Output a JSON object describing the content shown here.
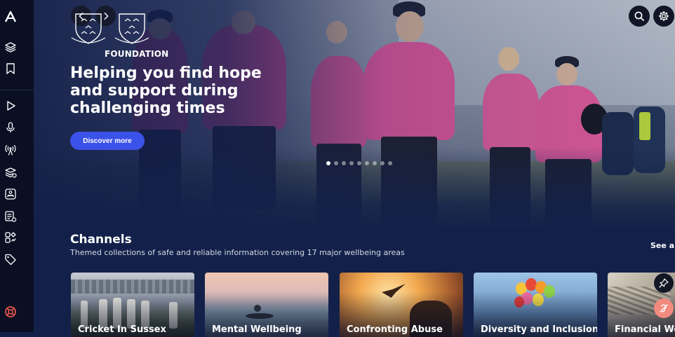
{
  "hero": {
    "title": "Helping you find hope and support during challenging times",
    "button_label": "Discover more",
    "logo_text": "FOUNDATION",
    "slide_count": 9,
    "active_slide": 1
  },
  "sidebar": {
    "items": [
      {
        "icon": "brand-logo-icon"
      },
      {
        "icon": "layers-icon"
      },
      {
        "icon": "bookmark-icon"
      },
      {
        "icon": "play-icon"
      },
      {
        "icon": "microphone-icon"
      },
      {
        "icon": "broadcast-icon"
      },
      {
        "icon": "courses-icon"
      },
      {
        "icon": "meditation-icon"
      },
      {
        "icon": "articles-icon"
      },
      {
        "icon": "apps-icon"
      },
      {
        "icon": "tag-icon"
      },
      {
        "icon": "lifebuoy-icon"
      }
    ]
  },
  "channels": {
    "title": "Channels",
    "subtitle": "Themed collections of safe and reliable information covering 17 major wellbeing areas",
    "see_all": "See all",
    "cards": [
      {
        "label": "Cricket In Sussex"
      },
      {
        "label": "Mental Wellbeing"
      },
      {
        "label": "Confronting Abuse"
      },
      {
        "label": "Diversity and Inclusion"
      },
      {
        "label": "Financial We"
      }
    ]
  },
  "colors": {
    "accent": "#3b52e8",
    "background": "#13214a",
    "sidebar": "#0a0f24",
    "kit_pink": "#e04e95",
    "sos": "#e8584a"
  }
}
